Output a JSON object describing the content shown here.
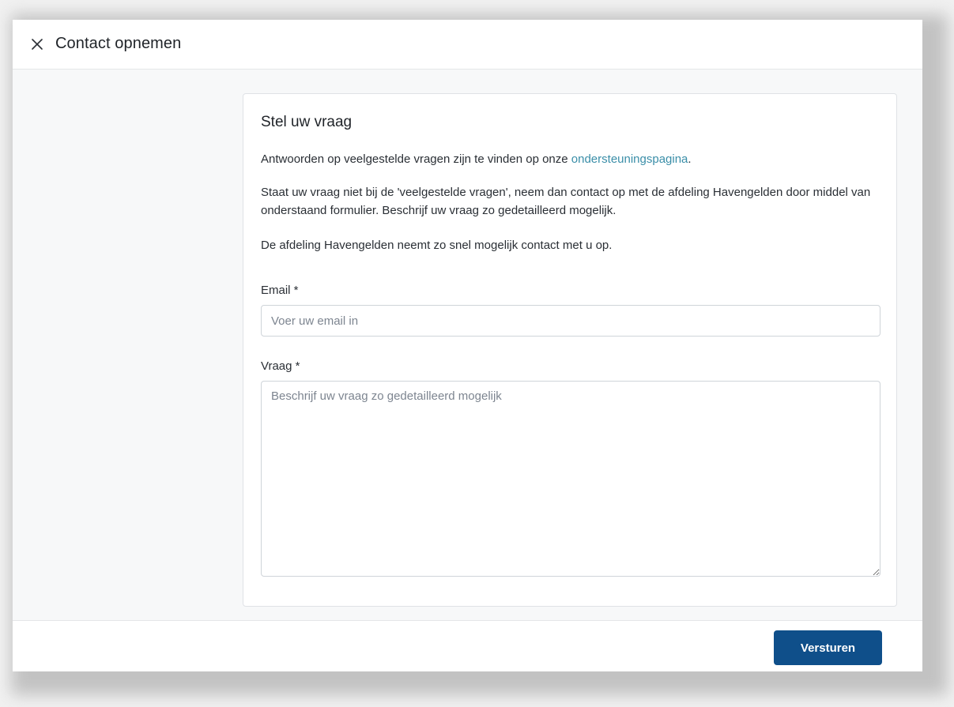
{
  "window": {
    "title": "Contact opnemen",
    "close_icon": "close-icon"
  },
  "card": {
    "title": "Stel uw vraag",
    "intro_before_link": "Antwoorden op veelgestelde vragen zijn te vinden op onze ",
    "intro_link": "ondersteuningspagina",
    "intro_after_link": ".",
    "paragraph_2": "Staat uw vraag niet bij de 'veelgestelde vragen', neem dan contact op met de afdeling Havengelden door middel van onderstaand formulier. Beschrijf uw vraag zo gedetailleerd mogelijk.",
    "paragraph_3": "De afdeling Havengelden neemt zo snel mogelijk contact met u op."
  },
  "form": {
    "email_label": "Email *",
    "email_placeholder": "Voer uw email in",
    "email_value": "",
    "question_label": "Vraag *",
    "question_placeholder": "Beschrijf uw vraag zo gedetailleerd mogelijk",
    "question_value": ""
  },
  "footer": {
    "submit_label": "Versturen"
  },
  "colors": {
    "primary_button": "#0f4f8a",
    "link": "#3a8ea8",
    "page_background": "#f7f8f9"
  }
}
